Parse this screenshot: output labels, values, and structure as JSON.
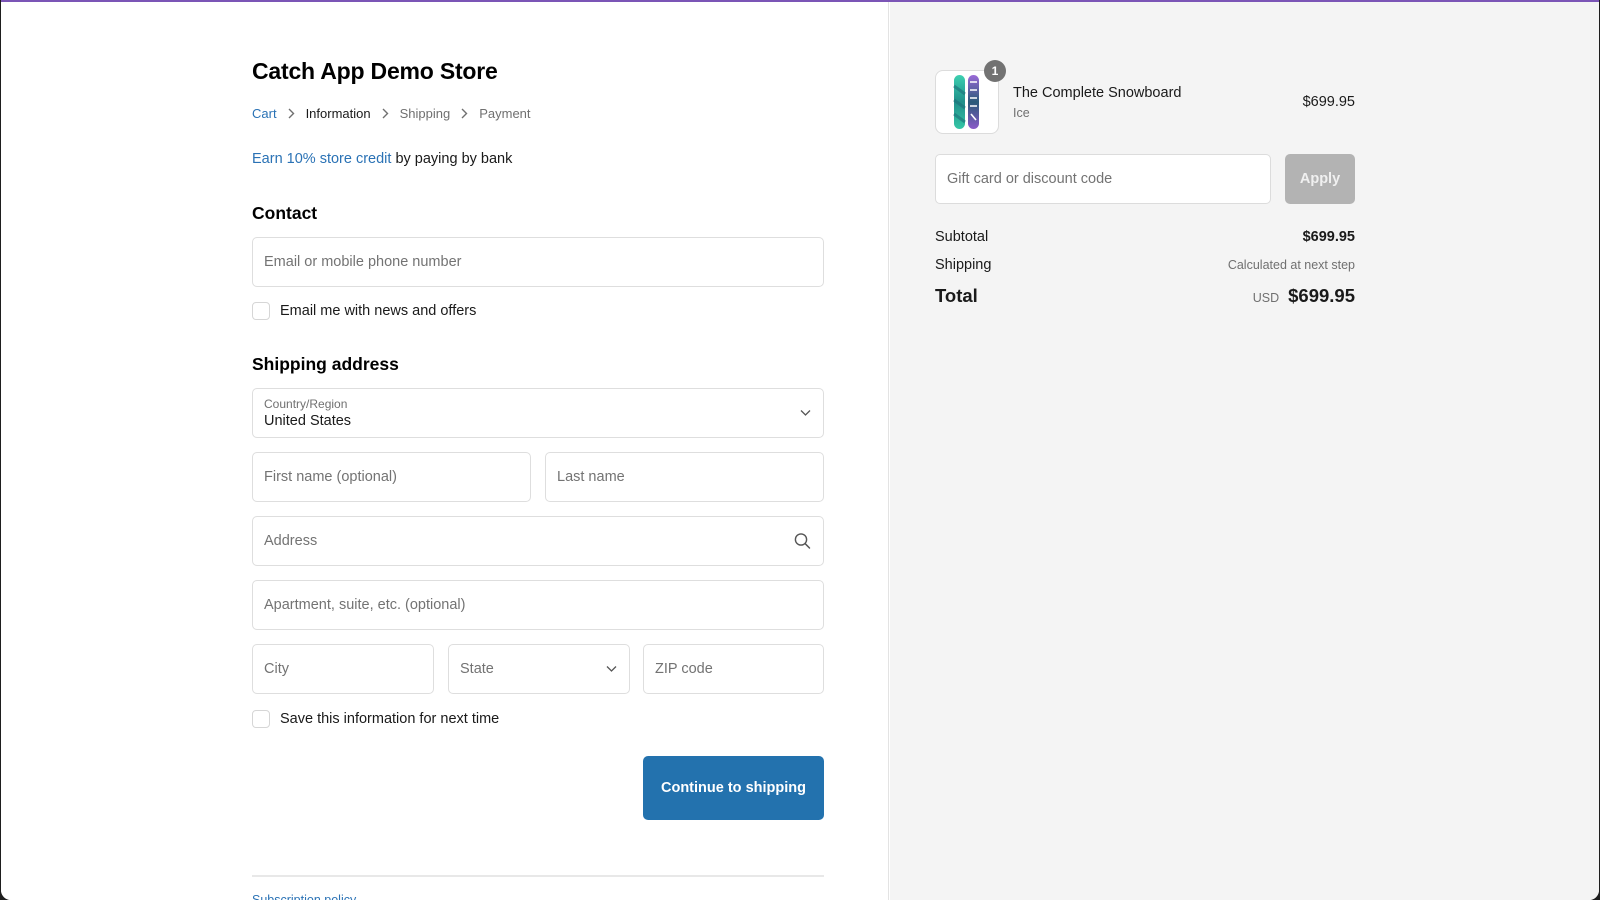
{
  "store": {
    "name": "Catch App Demo Store",
    "brand_color": "#2372ae",
    "accent_bar_color": "#7b55b6"
  },
  "breadcrumb": [
    {
      "label": "Cart",
      "state": "link"
    },
    {
      "label": "Information",
      "state": "current"
    },
    {
      "label": "Shipping",
      "state": "upcoming"
    },
    {
      "label": "Payment",
      "state": "upcoming"
    }
  ],
  "promo": {
    "link_text": "Earn 10% store credit",
    "rest_text": " by paying by bank"
  },
  "contact": {
    "title": "Contact",
    "email_placeholder": "Email or mobile phone number",
    "email_value": "",
    "newsletter_label": "Email me with news and offers",
    "newsletter_checked": false
  },
  "shipping_address": {
    "title": "Shipping address",
    "country_label": "Country/Region",
    "country_value": "United States",
    "first_name_placeholder": "First name (optional)",
    "last_name_placeholder": "Last name",
    "address_placeholder": "Address",
    "apartment_placeholder": "Apartment, suite, etc. (optional)",
    "city_placeholder": "City",
    "state_placeholder": "State",
    "zip_placeholder": "ZIP code",
    "save_info_label": "Save this information for next time",
    "save_info_checked": false
  },
  "actions": {
    "continue_label": "Continue to shipping"
  },
  "footer": {
    "links": [
      "Subscription policy"
    ]
  },
  "order_summary": {
    "items": [
      {
        "name": "The Complete Snowboard",
        "variant": "Ice",
        "price": "$699.95",
        "quantity": "1",
        "image_icon": "snowboard-image"
      }
    ],
    "discount_placeholder": "Gift card or discount code",
    "apply_label": "Apply",
    "subtotal_label": "Subtotal",
    "subtotal_value": "$699.95",
    "shipping_label": "Shipping",
    "shipping_value": "Calculated at next step",
    "total_label": "Total",
    "currency": "USD",
    "total_value": "$699.95"
  }
}
